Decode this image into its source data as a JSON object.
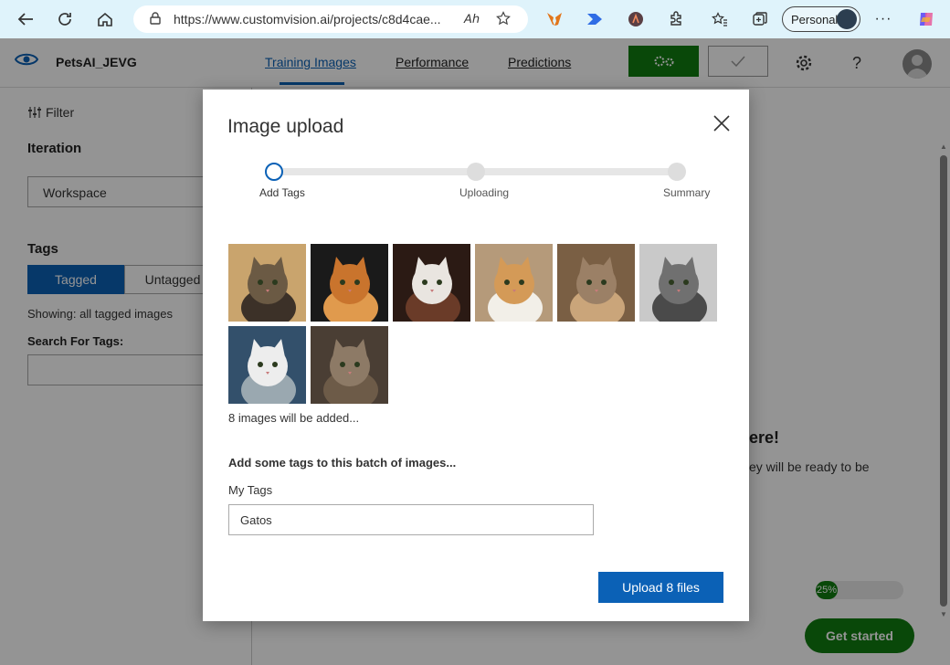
{
  "browser": {
    "url": "https://www.customvision.ai/projects/c8d4cae...",
    "profile_label": "Personal",
    "read_aloud_glyph": "𝘈ℎ"
  },
  "app": {
    "project_name": "PetsAI_JEVG",
    "tabs": [
      "Training Images",
      "Performance",
      "Predictions"
    ],
    "active_tab": "Training Images"
  },
  "sidebar": {
    "filter_label": "Filter",
    "iteration_heading": "Iteration",
    "iteration_value": "Workspace",
    "tags_heading": "Tags",
    "tagged_label": "Tagged",
    "untagged_label": "Untagged",
    "showing_text": "Showing: all tagged images",
    "search_label": "Search For Tags:"
  },
  "background": {
    "title_fragment": "ere!",
    "subtitle_fragment": "ey will be ready to be",
    "progress_text": "25%",
    "progress_value": 0.25,
    "get_started_label": "Get started"
  },
  "modal": {
    "title": "Image upload",
    "steps": [
      "Add Tags",
      "Uploading",
      "Summary"
    ],
    "active_step": 0,
    "images": [
      {
        "name": "cat-tabby-kitten",
        "colors": [
          "#c9a46d",
          "#6b5a44",
          "#3c3128"
        ]
      },
      {
        "name": "cat-orange-dark",
        "colors": [
          "#1a1a1a",
          "#c9742d",
          "#e09a4d"
        ]
      },
      {
        "name": "cat-white-kitten",
        "colors": [
          "#2b1a14",
          "#e9e5e0",
          "#6a3b28"
        ]
      },
      {
        "name": "cat-orange-white",
        "colors": [
          "#b59a7a",
          "#d49a57",
          "#f2efe8"
        ]
      },
      {
        "name": "cat-british-brown",
        "colors": [
          "#7a5f44",
          "#9b8066",
          "#caa57a"
        ]
      },
      {
        "name": "cat-grey",
        "colors": [
          "#c9c9c9",
          "#707070",
          "#4a4a4a"
        ]
      },
      {
        "name": "cat-white-fluffy",
        "colors": [
          "#33506b",
          "#ededed",
          "#9aa8b0"
        ]
      },
      {
        "name": "cat-tabby-adult",
        "colors": [
          "#4a3e34",
          "#8d7a66",
          "#6d5b48"
        ]
      }
    ],
    "count_text": "8 images will be added...",
    "tags_heading": "Add some tags to this batch of images...",
    "my_tags_label": "My Tags",
    "my_tags_value": "Gatos",
    "upload_button": "Upload 8 files"
  }
}
